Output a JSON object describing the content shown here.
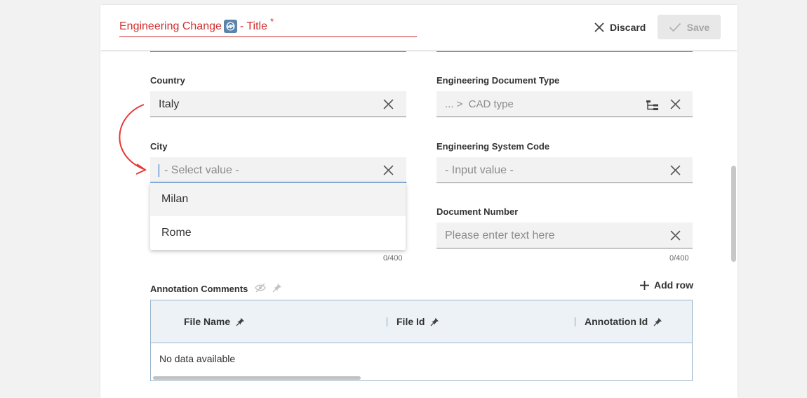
{
  "header": {
    "title": "Engineering Change",
    "title_suffix": "- Title",
    "required_mark": "*",
    "title_icon": "sync-icon",
    "discard_label": "Discard",
    "save_label": "Save"
  },
  "fields": {
    "country": {
      "label": "Country",
      "value": "Italy"
    },
    "engineering_document_type": {
      "label": "Engineering Document Type",
      "breadcrumb": "... >",
      "placeholder": "CAD type"
    },
    "city": {
      "label": "City",
      "placeholder": "- Select value -",
      "options": [
        "Milan",
        "Rome"
      ],
      "counter": "0/400"
    },
    "engineering_system_code": {
      "label": "Engineering System Code",
      "placeholder": "- Input value -"
    },
    "document_number": {
      "label": "Document Number",
      "placeholder": "Please enter text here",
      "counter": "0/400"
    }
  },
  "annotation_comments": {
    "label": "Annotation Comments",
    "add_row_label": "Add row",
    "columns": [
      "File Name",
      "File Id",
      "Annotation Id"
    ],
    "empty_text": "No data available"
  },
  "colors": {
    "accent_red": "#d32f2f",
    "focus_blue": "#1565c0",
    "table_border": "#9bb6cc",
    "annotation_arrow": "#e53935"
  }
}
